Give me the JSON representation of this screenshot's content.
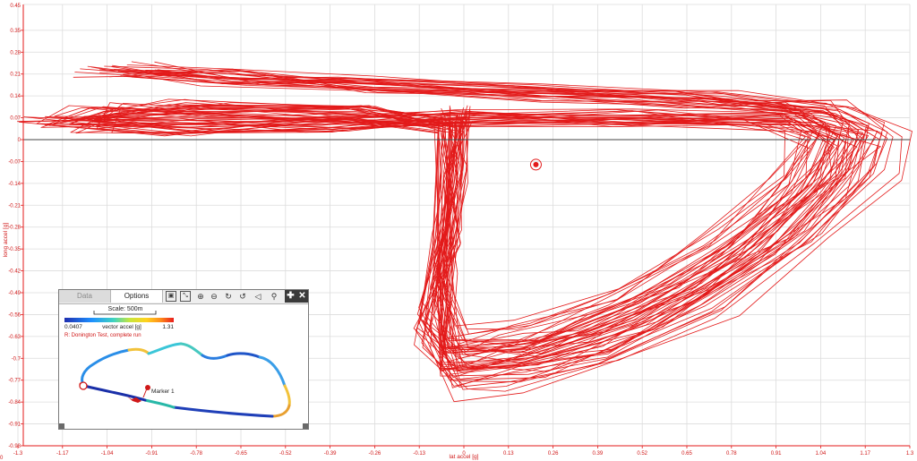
{
  "chart_data": {
    "type": "scatter",
    "title": "",
    "xlabel": "lat accel [g]",
    "ylabel": "long accel [g]",
    "xlim": [
      -1.3,
      1.3
    ],
    "ylim": [
      -0.98,
      0.45
    ],
    "x_ticks": [
      "-1.3",
      "-1.17",
      "-1.04",
      "-0.91",
      "-0.78",
      "-0.65",
      "-0.52",
      "-0.39",
      "-0.26",
      "-0.13",
      "0",
      "0.13",
      "0.26",
      "0.39",
      "0.52",
      "0.65",
      "0.78",
      "0.91",
      "1.04",
      "1.17",
      "1.3"
    ],
    "y_ticks": [
      "0.45",
      "0.35",
      "0.28",
      "0.21",
      "0.14",
      "0.07",
      "0",
      "-0.07",
      "-0.14",
      "-0.21",
      "-0.28",
      "-0.35",
      "-0.42",
      "-0.49",
      "-0.56",
      "-0.63",
      "-0.7",
      "-0.77",
      "-0.84",
      "-0.91",
      "-0.98"
    ],
    "grid": true,
    "series_color": "#e31a1a",
    "corner_label": "0",
    "cursor_point": {
      "x": 0.21,
      "y": -0.08
    },
    "series": [
      {
        "values": [
          {
            "x": -1.0,
            "y": 0.22
          },
          {
            "x": -0.7,
            "y": 0.2
          },
          {
            "x": -0.3,
            "y": 0.18
          },
          {
            "x": 0.2,
            "y": 0.15
          },
          {
            "x": 0.7,
            "y": 0.13
          },
          {
            "x": 1.05,
            "y": 0.1
          },
          {
            "x": 1.15,
            "y": 0.03
          },
          {
            "x": 1.12,
            "y": -0.1
          },
          {
            "x": 0.95,
            "y": -0.3
          },
          {
            "x": 0.7,
            "y": -0.5
          },
          {
            "x": 0.4,
            "y": -0.65
          },
          {
            "x": 0.15,
            "y": -0.72
          },
          {
            "x": -0.03,
            "y": -0.74
          },
          {
            "x": -0.1,
            "y": -0.6
          },
          {
            "x": -0.05,
            "y": -0.3
          },
          {
            "x": -0.04,
            "y": 0.05
          },
          {
            "x": -0.3,
            "y": 0.08
          },
          {
            "x": -0.8,
            "y": 0.1
          },
          {
            "x": -1.05,
            "y": 0.09
          },
          {
            "x": -1.15,
            "y": 0.05
          },
          {
            "x": -0.8,
            "y": 0.04
          },
          {
            "x": -0.4,
            "y": 0.05
          },
          {
            "x": 0.0,
            "y": 0.07
          },
          {
            "x": 0.5,
            "y": 0.07
          },
          {
            "x": 0.95,
            "y": 0.06
          },
          {
            "x": 1.08,
            "y": 0.0
          },
          {
            "x": 1.0,
            "y": -0.15
          },
          {
            "x": 0.8,
            "y": -0.35
          },
          {
            "x": 0.5,
            "y": -0.55
          },
          {
            "x": 0.2,
            "y": -0.67
          },
          {
            "x": -0.03,
            "y": -0.68
          },
          {
            "x": -0.06,
            "y": -0.45
          },
          {
            "x": -0.03,
            "y": -0.1
          },
          {
            "x": -0.02,
            "y": 0.08
          }
        ]
      }
    ]
  },
  "map_panel": {
    "tabs": [
      "Data",
      "Options"
    ],
    "scale_label": "Scale: 500m",
    "legend_title": "vector accel [g]",
    "legend_min": "0.0407",
    "legend_max": "1.31",
    "run_label": "R:  Donington Test, complete run",
    "marker_label": "Marker 1",
    "icons": [
      "map-view-icon",
      "zoom-fit-icon",
      "zoom-in-icon",
      "zoom-out-icon",
      "rotate-cw-icon",
      "rotate-ccw-icon",
      "speaker-icon",
      "pin-icon",
      "move-icon",
      "close-icon"
    ]
  }
}
